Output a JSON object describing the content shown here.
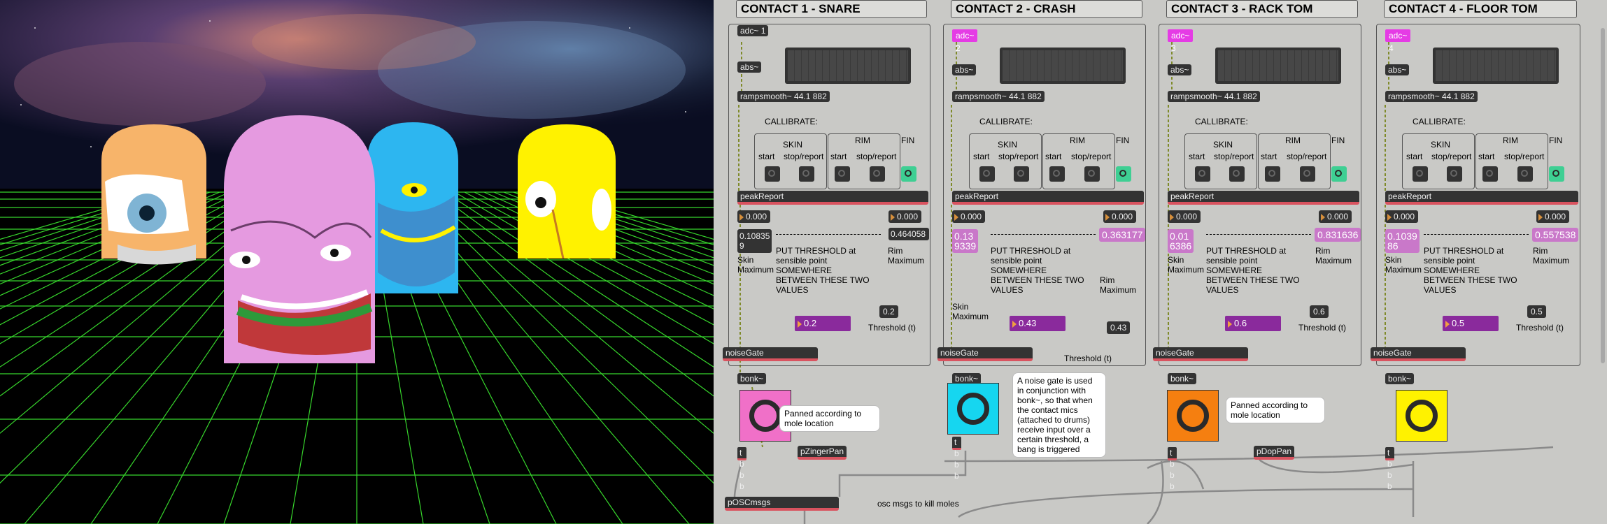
{
  "panels": [
    {
      "title": "CONTACT 1 - SNARE",
      "adc": "adc~ 1",
      "abs": "abs~",
      "ramp": "rampsmooth~ 44.1 882",
      "callibrate": "CALLIBRATE:",
      "skin": "SKIN",
      "rim": "RIM",
      "fin": "FIN",
      "start1": "start",
      "stop1": "stop/report",
      "start2": "start",
      "stop2": "stop/report",
      "peak": "peakReport",
      "n1": "0.000",
      "n2": "0.000",
      "skinmax": "0.10835\n9",
      "rimmax": "0.464058",
      "skinlbl": "Skin\nMaximum",
      "rimlbl": "Rim\nMaximum",
      "put": "PUT THRESHOLD at\nsensible point\nSOMEWHERE\nBETWEEN THESE TWO\nVALUES",
      "th": "0.2",
      "thv": "0.2",
      "thlbl": "Threshold (t)",
      "noise": "noiseGate",
      "bonk": "bonk~",
      "tbbb": "t b b b"
    },
    {
      "title": "CONTACT 2 - CRASH",
      "adc": "adc~ 2",
      "abs": "abs~",
      "ramp": "rampsmooth~ 44.1 882",
      "callibrate": "CALLIBRATE:",
      "skin": "SKIN",
      "rim": "RIM",
      "fin": "FIN",
      "start1": "start",
      "stop1": "stop/report",
      "start2": "start",
      "stop2": "stop/report",
      "peak": "peakReport",
      "n1": "0.000",
      "n2": "0.000",
      "skinmax": "0.13\n9339",
      "rimmax": "0.363177",
      "skinlbl": "Skin\nMaximum",
      "rimlbl": "Rim\nMaximum",
      "put": "PUT THRESHOLD at\nsensible point\nSOMEWHERE\nBETWEEN THESE TWO\nVALUES",
      "th": "0.43",
      "thv": "0.43",
      "thlbl": "Threshold (t)",
      "noise": "noiseGate",
      "bonk": "bonk~",
      "tbbb": "t b b b"
    },
    {
      "title": "CONTACT 3 - RACK TOM",
      "adc": "adc~ 3",
      "abs": "abs~",
      "ramp": "rampsmooth~ 44.1 882",
      "callibrate": "CALLIBRATE:",
      "skin": "SKIN",
      "rim": "RIM",
      "fin": "FIN",
      "start1": "start",
      "stop1": "stop/report",
      "start2": "start",
      "stop2": "stop/report",
      "peak": "peakReport",
      "n1": "0.000",
      "n2": "0.000",
      "skinmax": "0.01\n6386",
      "rimmax": "0.831636",
      "skinlbl": "Skin\nMaximum",
      "rimlbl": "Rim\nMaximum",
      "put": "PUT THRESHOLD at\nsensible point\nSOMEWHERE\nBETWEEN THESE TWO\nVALUES",
      "th": "0.6",
      "thv": "0.6",
      "thlbl": "Threshold (t)",
      "noise": "noiseGate",
      "bonk": "bonk~",
      "tbbb": "t b b b"
    },
    {
      "title": "CONTACT 4 - FLOOR TOM",
      "adc": "adc~ 4",
      "abs": "abs~",
      "ramp": "rampsmooth~ 44.1 882",
      "callibrate": "CALLIBRATE:",
      "skin": "SKIN",
      "rim": "RIM",
      "fin": "FIN",
      "start1": "start",
      "stop1": "stop/report",
      "start2": "start",
      "stop2": "stop/report",
      "peak": "peakReport",
      "n1": "0.000",
      "n2": "0.000",
      "skinmax": "0.1039\n86",
      "rimmax": "0.557538",
      "skinlbl": "Skin\nMaximum",
      "rimlbl": "Rim\nMaximum",
      "put": "PUT THRESHOLD at\nsensible point\nSOMEWHERE\nBETWEEN THESE TWO\nVALUES",
      "th": "0.5",
      "thv": "0.5",
      "thlbl": "Threshold (t)",
      "noise": "noiseGate",
      "bonk": "bonk~",
      "tbbb": "t b b b"
    }
  ],
  "bottom": {
    "pzinger": "pZingerPan",
    "pdop": "pDopPan",
    "posc": "pOSCmsgs",
    "osc_comment": "osc msgs to kill moles",
    "panned1": "Panned according to mole location",
    "panned2": "Panned according to mole location",
    "noisegate_note": "A noise gate is used in conjunction with bonk~, so that when the contact mics (attached to drums) receive input over a certain threshold, a bang is triggered"
  },
  "colors": {
    "bang1": "#f070c8",
    "bang2": "#16d6f0",
    "bang3": "#f57f10",
    "bang4": "#fff200",
    "mole1": "#f7b46a",
    "mole2": "#e59ae0",
    "mole3": "#2db6f0",
    "mole4": "#fff200",
    "grid": "#37d62c"
  }
}
